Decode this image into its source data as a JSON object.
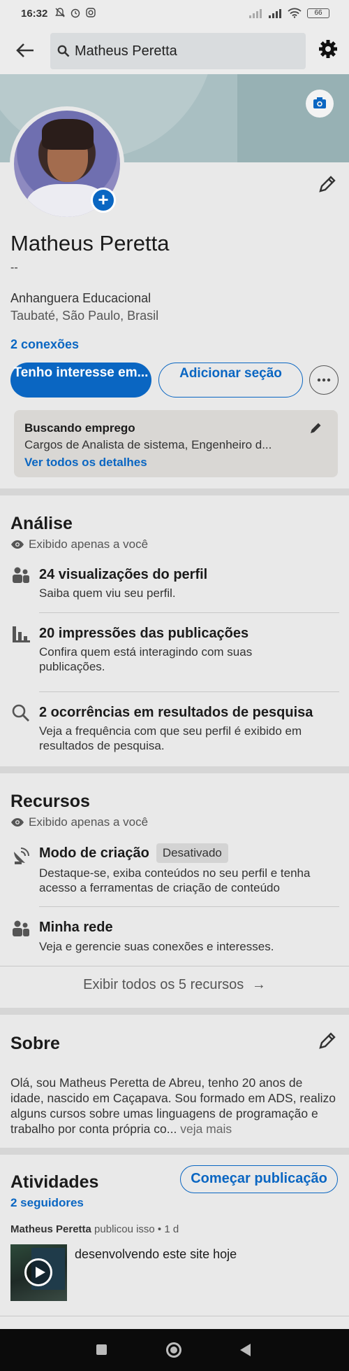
{
  "status_bar": {
    "time": "16:32",
    "battery": "66"
  },
  "header": {
    "search_text": "Matheus Peretta"
  },
  "profile": {
    "name": "Matheus Peretta",
    "headline": "--",
    "education": "Anhanguera Educacional",
    "location": "Taubaté, São Paulo, Brasil",
    "connections": "2 conexões",
    "primary_button": "Tenho interesse em...",
    "secondary_button": "Adicionar seção"
  },
  "open_to_work": {
    "title": "Buscando emprego",
    "description": "Cargos de Analista de sistema, Engenheiro d...",
    "link": "Ver todos os detalhes"
  },
  "analytics": {
    "title": "Análise",
    "private_note": "Exibido apenas a você",
    "items": [
      {
        "icon": "people-icon",
        "title": "24 visualizações do perfil",
        "desc": "Saiba quem viu seu perfil."
      },
      {
        "icon": "bar-chart-icon",
        "title": "20 impressões das publicações",
        "desc": "Confira quem está interagindo com suas publicações."
      },
      {
        "icon": "search-icon",
        "title": "2 ocorrências em resultados de pesquisa",
        "desc": "Veja a frequência com que seu perfil é exibido em resultados de pesquisa."
      }
    ]
  },
  "resources": {
    "title": "Recursos",
    "private_note": "Exibido apenas a você",
    "items": [
      {
        "icon": "satellite-dish-icon",
        "title": "Modo de criação",
        "badge": "Desativado",
        "desc": "Destaque-se, exiba conteúdos no seu perfil e tenha acesso a ferramentas de criação de conteúdo"
      },
      {
        "icon": "people-icon",
        "title": "Minha rede",
        "desc": "Veja e gerencie suas conexões e interesses."
      }
    ],
    "show_all": "Exibir todos os 5 recursos"
  },
  "about": {
    "title": "Sobre",
    "text": "Olá, sou Matheus Peretta de Abreu, tenho 20 anos de idade,  nascido em Caçapava. Sou formado em ADS, realizo alguns cursos sobre umas linguagens de programação e trabalho por conta própria co...",
    "more": "veja mais"
  },
  "activity": {
    "title": "Atividades",
    "post_button": "Começar publicação",
    "followers": "2 seguidores",
    "author": "Matheus Peretta",
    "meta": "publicou isso • 1 d",
    "post_text": "desenvolvendo este site hoje"
  },
  "colors": {
    "accent": "#0a66c2",
    "background": "#e9e9e9"
  }
}
